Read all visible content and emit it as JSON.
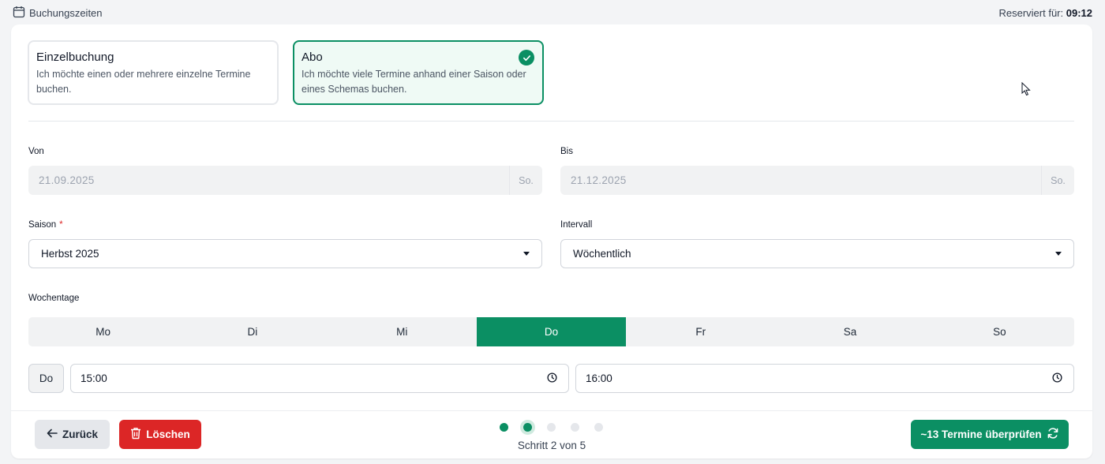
{
  "header": {
    "title": "Buchungszeiten",
    "reserved_label": "Reserviert für:",
    "reserved_time": "09:12"
  },
  "booking_types": [
    {
      "title": "Einzelbuchung",
      "description": "Ich möchte einen oder mehrere einzelne Termine buchen.",
      "selected": false
    },
    {
      "title": "Abo",
      "description": "Ich möchte viele Termine anhand einer Saison oder eines Schemas buchen.",
      "selected": true
    }
  ],
  "form": {
    "from_label": "Von",
    "from_value": "21.09.2025",
    "from_weekday": "So.",
    "to_label": "Bis",
    "to_value": "21.12.2025",
    "to_weekday": "So.",
    "season_label": "Saison",
    "season_required": "*",
    "season_value": "Herbst 2025",
    "interval_label": "Intervall",
    "interval_value": "Wöchentlich",
    "weekdays_label": "Wochentage",
    "weekdays": [
      "Mo",
      "Di",
      "Mi",
      "Do",
      "Fr",
      "Sa",
      "So"
    ],
    "selected_weekday": "Do",
    "time_row_day": "Do",
    "start_time": "15:00",
    "end_time": "16:00"
  },
  "footer": {
    "back_label": "Zurück",
    "delete_label": "Löschen",
    "next_label": "~13 Termine überprüfen",
    "step_text": "Schritt 2 von 5",
    "current_step": 2,
    "total_steps": 5
  },
  "colors": {
    "primary": "#0b8f63",
    "danger": "#dc2626",
    "selected_bg": "#effaf5"
  }
}
